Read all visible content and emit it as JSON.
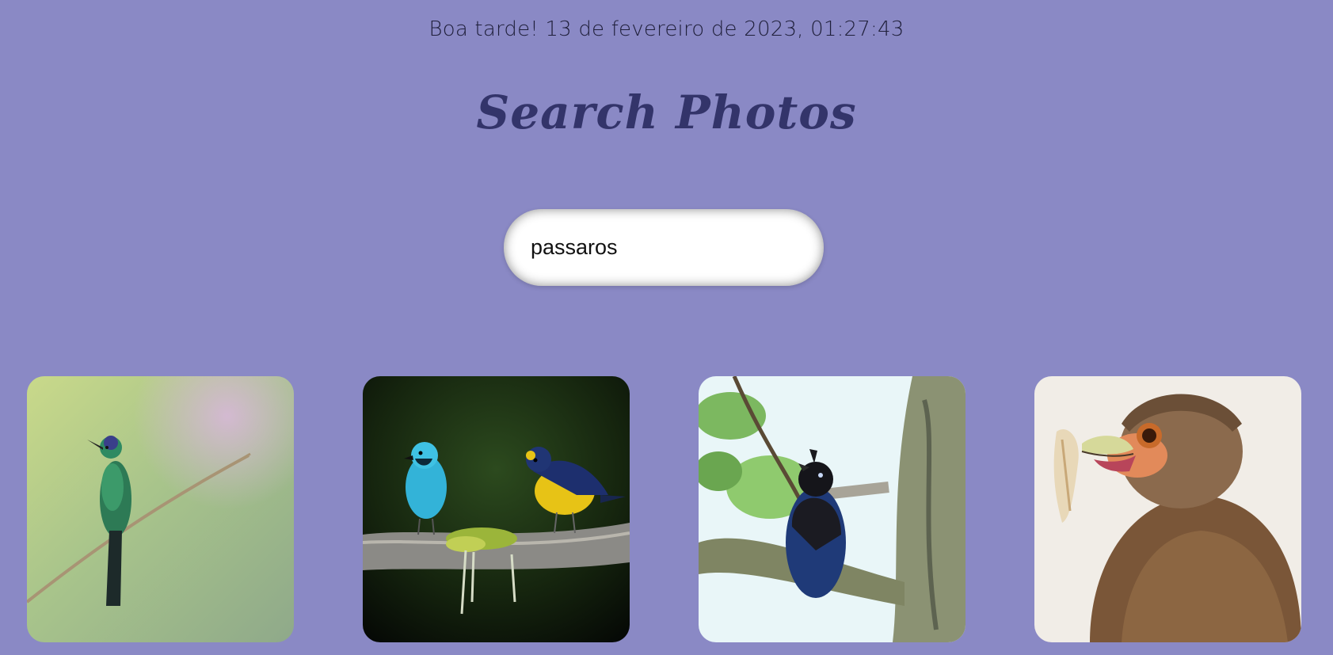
{
  "greeting": "Boa tarde! 13 de fevereiro de 2023, 01:27:43",
  "title": "Search Photos",
  "search": {
    "value": "passaros"
  },
  "results": [
    {
      "subject": "green hummingbird on a twig"
    },
    {
      "subject": "two birds (turquoise and blue-yellow) on a mossy branch"
    },
    {
      "subject": "dark blue jay in a tree"
    },
    {
      "subject": "brown caracara close-up"
    }
  ],
  "colors": {
    "background": "#8a89c5",
    "title": "#33346a",
    "greeting": "#1f1f3a"
  }
}
